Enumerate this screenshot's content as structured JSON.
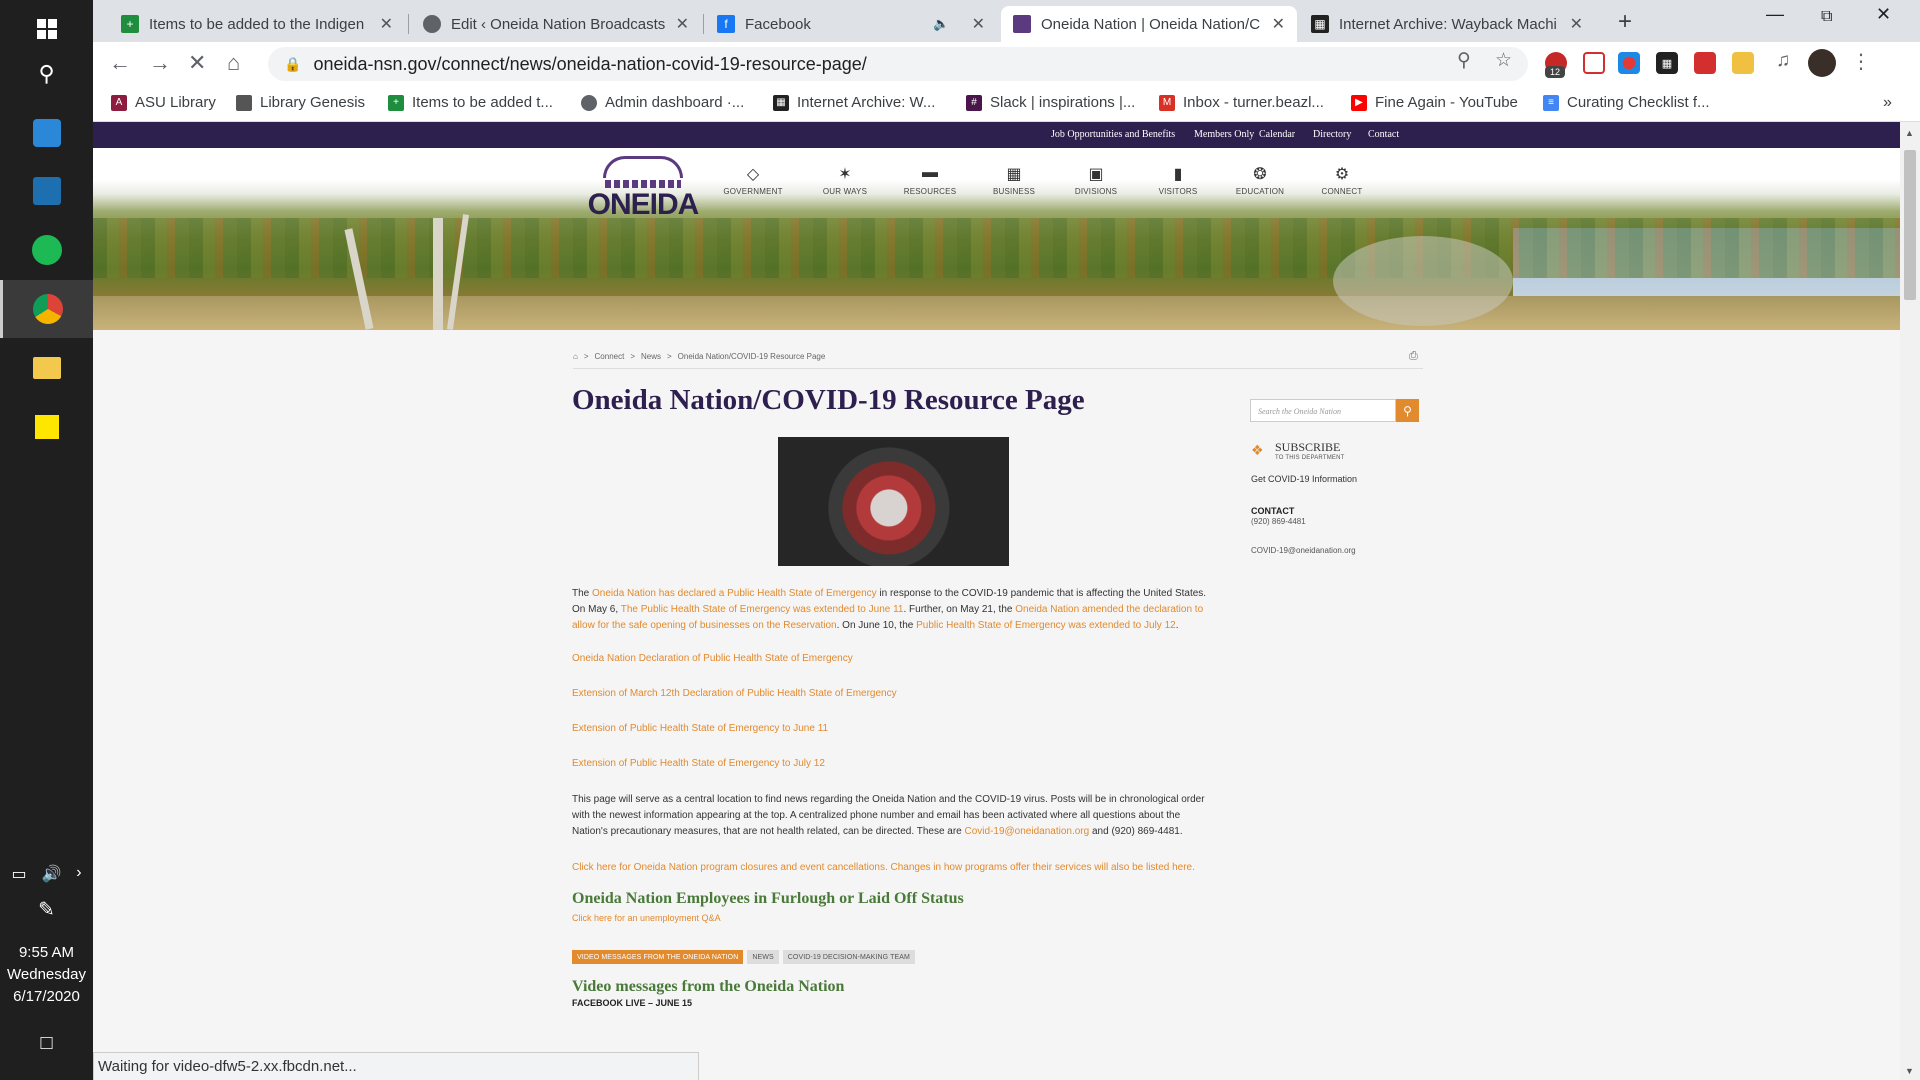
{
  "taskbar": {
    "time": "9:55 AM",
    "day": "Wednesday",
    "date": "6/17/2020"
  },
  "tabs": [
    {
      "title": "Items to be added to the Indigen",
      "favicon_color": "#1e8e3e"
    },
    {
      "title": "Edit ‹ Oneida Nation Broadcasts ‹",
      "favicon_color": "#5f6368"
    },
    {
      "title": "Facebook",
      "favicon_color": "#1877f2"
    },
    {
      "title": "Oneida Nation | Oneida Nation/C",
      "favicon_color": "#5b3a80"
    },
    {
      "title": "Internet Archive: Wayback Machi",
      "favicon_color": "#222222"
    }
  ],
  "address": {
    "url": "oneida-nsn.gov/connect/news/oneida-nation-covid-19-resource-page/"
  },
  "extensions": {
    "badge": "12"
  },
  "bookmarks": [
    {
      "label": "ASU Library",
      "color": "#8c1d40"
    },
    {
      "label": "Library Genesis",
      "color": "#555555"
    },
    {
      "label": "Items to be added t...",
      "color": "#1e8e3e"
    },
    {
      "label": "Admin dashboard ·...",
      "color": "#5f6368"
    },
    {
      "label": "Internet Archive: W...",
      "color": "#222222"
    },
    {
      "label": "Slack | inspirations |...",
      "color": "#4a154b"
    },
    {
      "label": "Inbox - turner.beazl...",
      "color": "#d93025"
    },
    {
      "label": "Fine Again - YouTube",
      "color": "#ff0000"
    },
    {
      "label": "Curating Checklist f...",
      "color": "#4285f4"
    }
  ],
  "site": {
    "top_links": [
      "Job Opportunities and Benefits",
      "Members Only",
      "Calendar",
      "Directory",
      "Contact"
    ],
    "logo_text": "ONEIDA",
    "nav": [
      {
        "label": "GOVERNMENT",
        "icon": "diamond-icon",
        "glyph": "◇"
      },
      {
        "label": "OUR WAYS",
        "icon": "bird-icon",
        "glyph": "✶"
      },
      {
        "label": "RESOURCES",
        "icon": "folder-icon",
        "glyph": "▬"
      },
      {
        "label": "BUSINESS",
        "icon": "building-icon",
        "glyph": "▦"
      },
      {
        "label": "DIVISIONS",
        "icon": "grid-icon",
        "glyph": "▣"
      },
      {
        "label": "VISITORS",
        "icon": "briefcase-icon",
        "glyph": "▮"
      },
      {
        "label": "EDUCATION",
        "icon": "turtle-icon",
        "glyph": "❂"
      },
      {
        "label": "CONNECT",
        "icon": "connect-icon",
        "glyph": "⚙"
      }
    ],
    "breadcrumb": [
      "Connect",
      "News",
      "Oneida Nation/COVID-19 Resource Page"
    ],
    "title": "Oneida Nation/COVID-19 Resource Page",
    "intro": {
      "t1": "The ",
      "l1": "Oneida Nation has declared a Public Health State of Emergency",
      "t2": " in response to the COVID-19 pandemic that is affecting the United States. On May 6, ",
      "l2": "The Public Health State of Emergency was extended to June 11",
      "t3": ". Further, on May 21, the ",
      "l3": "Oneida Nation amended the declaration to allow for the safe opening of businesses on the Reservation",
      "t4": ". On June 10, the ",
      "l4": "Public Health State of Emergency was extended to July 12",
      "t5": "."
    },
    "doc_links": [
      "Oneida Nation Declaration of Public Health State of Emergency",
      "Extension of March 12th Declaration of Public Health State of Emergency",
      "Extension of Public Health State of Emergency to June 11",
      "Extension of Public Health State of Emergency to July 12"
    ],
    "central": {
      "text": "This page will serve as a central location to find news regarding the Oneida Nation and the COVID-19 virus. Posts will be in chronological order with the newest information appearing at the top. A centralized phone number and email has been activated where all questions about the Nation's precautionary measures, that are not health related, can be directed. These are ",
      "email": "Covid-19@oneidanation.org",
      "tail": "  and (920) 869-4481."
    },
    "closures": "Click here for Oneida Nation program closures and event cancellations. Changes in how programs offer their services will also be listed here.",
    "furlough_heading": "Oneida Nation Employees in Furlough or Laid Off Status",
    "unemployment_link": "Click here for an unemployment Q&A",
    "content_tabs": [
      "VIDEO MESSAGES FROM THE ONEIDA NATION",
      "NEWS",
      "COVID-19 DECISION-MAKING TEAM"
    ],
    "video_heading": "Video messages from the Oneida Nation",
    "fb_live": "FACEBOOK LIVE – JUNE 15",
    "sidebar": {
      "search_placeholder": "Search the Oneida Nation",
      "subscribe": "SUBSCRIBE",
      "subscribe_sub": "TO THIS DEPARTMENT",
      "get_info": "Get COVID-19 Information",
      "contact_label": "CONTACT",
      "phone": "(920) 869-4481",
      "email": "COVID-19@oneidanation.org"
    }
  },
  "status": "Waiting for video-dfw5-2.xx.fbcdn.net..."
}
